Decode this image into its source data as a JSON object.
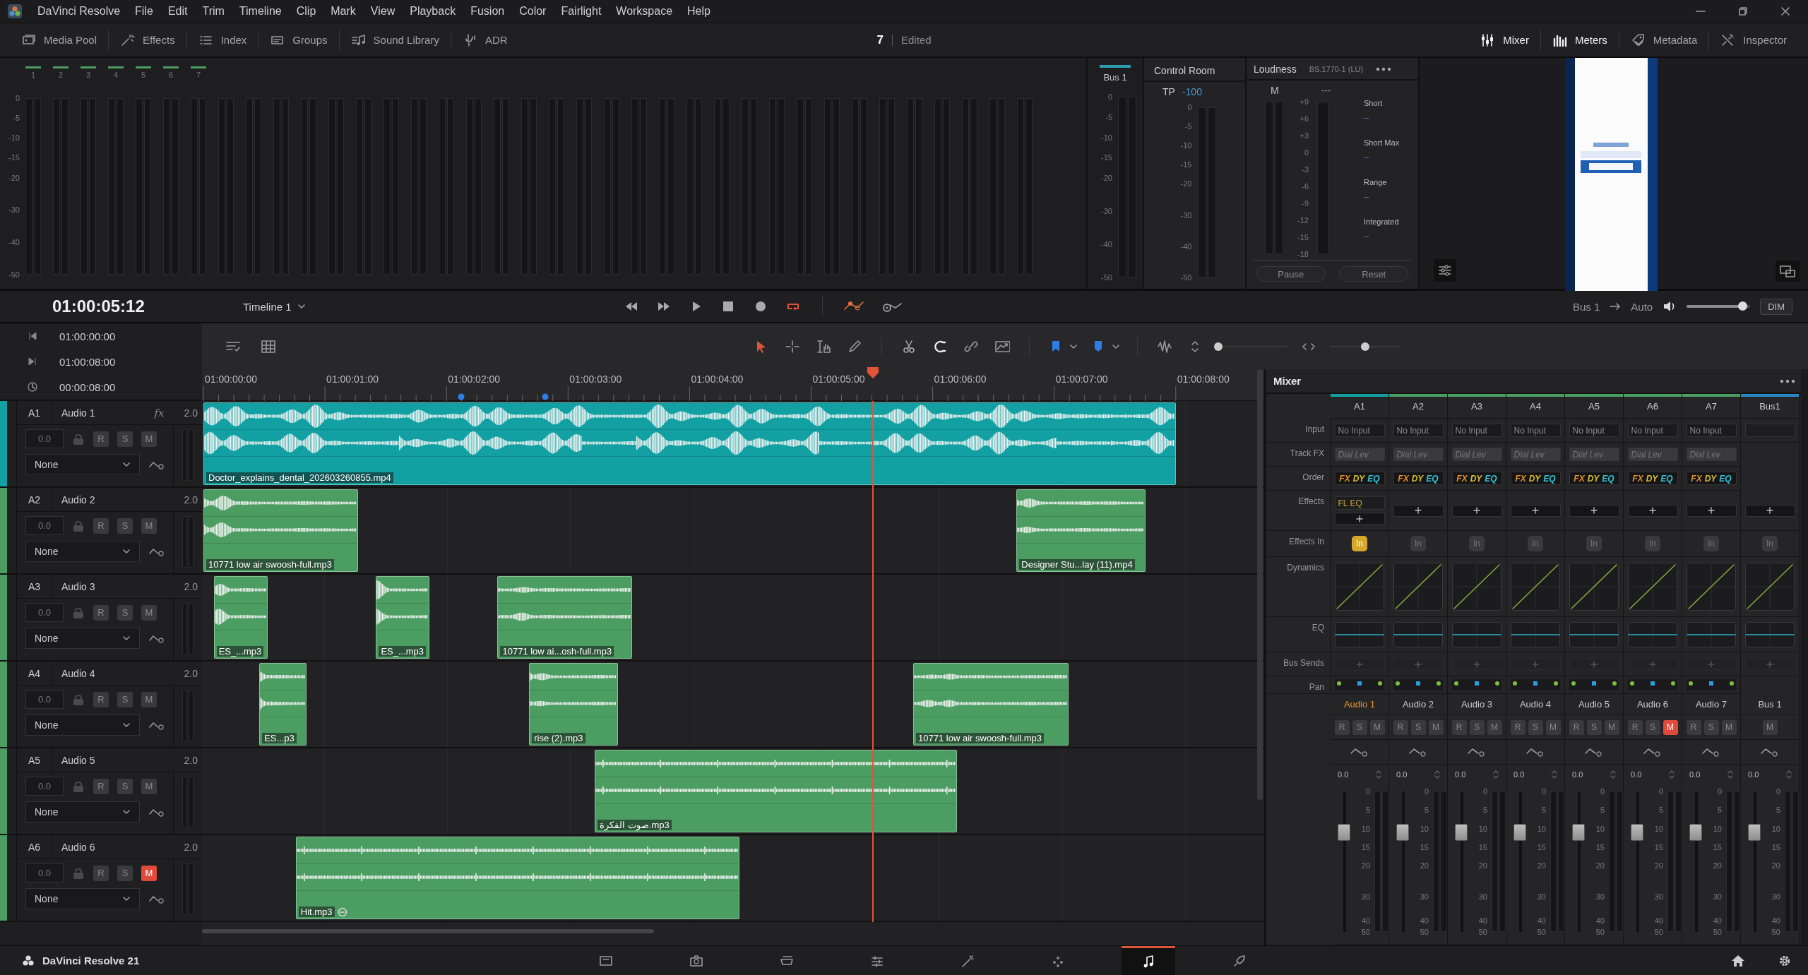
{
  "menu_bar": {
    "app_name": "DaVinci Resolve",
    "items": [
      "File",
      "Edit",
      "Trim",
      "Timeline",
      "Clip",
      "Mark",
      "View",
      "Playback",
      "Fusion",
      "Color",
      "Fairlight",
      "Workspace",
      "Help"
    ]
  },
  "toolbar": {
    "left": [
      {
        "label": "Media Pool"
      },
      {
        "label": "Effects"
      },
      {
        "label": "Index"
      },
      {
        "label": "Groups"
      },
      {
        "label": "Sound Library"
      },
      {
        "label": "ADR"
      }
    ],
    "project": "7",
    "status": "Edited",
    "right": [
      {
        "label": "Mixer",
        "selected": true
      },
      {
        "label": "Meters",
        "selected": true
      },
      {
        "label": "Metadata",
        "selected": false
      },
      {
        "label": "Inspector",
        "selected": false
      }
    ]
  },
  "meters": {
    "channels": [
      "1",
      "2",
      "3",
      "4",
      "5",
      "6",
      "7"
    ],
    "scale": [
      "0",
      "-5",
      "-10",
      "-15",
      "-20",
      "-30",
      "-40",
      "-50"
    ]
  },
  "bus_meter": {
    "title": "Bus 1",
    "scale": [
      "0",
      "-5",
      "-10",
      "-15",
      "-20",
      "-30",
      "-40",
      "-50"
    ]
  },
  "control_room": {
    "title": "Control Room",
    "tp_label": "TP",
    "tp_value": "-100",
    "scale": [
      "0",
      "-5",
      "-10",
      "-15",
      "-20",
      "-30",
      "-40",
      "-50"
    ]
  },
  "loudness": {
    "title": "Loudness",
    "standard": "BS.1770-1 (LU)",
    "m_label": "M",
    "m_value": "---",
    "scale": [
      "+9",
      "+6",
      "+3",
      "0",
      "-3",
      "-6",
      "-9",
      "-12",
      "-15",
      "-18"
    ],
    "readings": [
      {
        "label": "Short",
        "value": "--"
      },
      {
        "label": "Short Max",
        "value": "--"
      },
      {
        "label": "Range",
        "value": "--"
      },
      {
        "label": "Integrated",
        "value": "--"
      }
    ],
    "buttons": [
      "Pause",
      "Reset"
    ]
  },
  "transport": {
    "timecode": "01:00:05:12",
    "timeline": "Timeline 1",
    "loop": true,
    "output": "Bus 1",
    "mode": "Auto",
    "volume": {
      "level": 0.88
    },
    "dim": "DIM"
  },
  "timecodes": [
    "01:00:00:00",
    "01:00:08:00",
    "00:00:08:00"
  ],
  "zoom_sliders": [
    {
      "level": 0.02
    },
    {
      "level": 0.5
    }
  ],
  "ruler": [
    "01:00:00:00",
    "01:00:01:00",
    "01:00:02:00",
    "01:00:03:00",
    "01:00:04:00",
    "01:00:05:00",
    "01:00:06:00",
    "01:00:07:00",
    "01:00:08:00"
  ],
  "tracks": [
    {
      "id": "A1",
      "name": "Audio 1",
      "fx": "fx",
      "format": "2.0",
      "color": "#13a0a2",
      "volume": "0.0",
      "record": {
        "label": "R",
        "on": false
      },
      "solo": {
        "label": "S",
        "on": false
      },
      "mute": {
        "label": "M",
        "on": false
      },
      "automation": "None",
      "clips": [
        {
          "label": "Doctor_explains_dental_202603260855.mp4"
        }
      ]
    },
    {
      "id": "A2",
      "name": "Audio 2",
      "format": "2.0",
      "color": "#4b9d62",
      "volume": "0.0",
      "record": {
        "label": "R",
        "on": false
      },
      "solo": {
        "label": "S",
        "on": false
      },
      "mute": {
        "label": "M",
        "on": false
      },
      "automation": "None",
      "clips": [
        {
          "label": "10771 low air swoosh-full.mp3"
        },
        {
          "label": "Designer Stu...lay (11).mp4"
        }
      ]
    },
    {
      "id": "A3",
      "name": "Audio 3",
      "format": "2.0",
      "color": "#4b9d62",
      "volume": "0.0",
      "record": {
        "label": "R",
        "on": false
      },
      "solo": {
        "label": "S",
        "on": false
      },
      "mute": {
        "label": "M",
        "on": false
      },
      "automation": "None",
      "clips": [
        {
          "label": "ES_...mp3"
        },
        {
          "label": "ES_...mp3"
        },
        {
          "label": "10771 low ai...osh-full.mp3"
        }
      ]
    },
    {
      "id": "A4",
      "name": "Audio 4",
      "format": "2.0",
      "color": "#4b9d62",
      "volume": "0.0",
      "record": {
        "label": "R",
        "on": false
      },
      "solo": {
        "label": "S",
        "on": false
      },
      "mute": {
        "label": "M",
        "on": false
      },
      "automation": "None",
      "clips": [
        {
          "label": "ES...p3"
        },
        {
          "label": "rise (2).mp3"
        },
        {
          "label": "10771 low air swoosh-full.mp3"
        }
      ]
    },
    {
      "id": "A5",
      "name": "Audio 5",
      "format": "2.0",
      "color": "#4b9d62",
      "volume": "0.0",
      "record": {
        "label": "R",
        "on": false
      },
      "solo": {
        "label": "S",
        "on": false
      },
      "mute": {
        "label": "M",
        "on": false
      },
      "automation": "None",
      "clips": [
        {
          "label": "صوت الفكرة.mp3"
        }
      ]
    },
    {
      "id": "A6",
      "name": "Audio 6",
      "format": "2.0",
      "color": "#4b9d62",
      "volume": "0.0",
      "record": {
        "label": "R",
        "on": false
      },
      "solo": {
        "label": "S",
        "on": false
      },
      "mute": {
        "label": "M",
        "on": true
      },
      "automation": "None",
      "clips": [
        {
          "label": "Hit.mp3",
          "status_icon": true
        }
      ]
    }
  ],
  "mixer": {
    "title": "Mixer",
    "row_labels": [
      "Input",
      "Track FX",
      "Order",
      "Effects",
      "Effects In",
      "Dynamics",
      "EQ",
      "Bus Sends",
      "Pan"
    ],
    "channels": [
      {
        "id": "A1",
        "kind": "track",
        "color": "#13a0a2",
        "input": "No Input",
        "track_fx": "Dial Lev",
        "order": [
          "FX",
          "DY",
          "EQ"
        ],
        "effects": [
          "FL EQ"
        ],
        "effects_in": true,
        "effects_in_label": "In",
        "name": "Audio 1",
        "selected": true,
        "record": {
          "label": "R",
          "on": false
        },
        "solo": {
          "label": "S",
          "on": false
        },
        "mute": {
          "label": "M",
          "on": false
        },
        "volume": "0.0",
        "level": 0.71,
        "scale": [
          "0",
          "5",
          "10",
          "15",
          "20",
          "30",
          "40",
          "50"
        ]
      },
      {
        "id": "A2",
        "kind": "track",
        "color": "#4b9d62",
        "input": "No Input",
        "track_fx": "Dial Lev",
        "order": [
          "FX",
          "DY",
          "EQ"
        ],
        "effects_in": false,
        "effects_in_label": "In",
        "name": "Audio 2",
        "selected": false,
        "record": {
          "label": "R",
          "on": false
        },
        "solo": {
          "label": "S",
          "on": false
        },
        "mute": {
          "label": "M",
          "on": false
        },
        "volume": "0.0",
        "level": 0.71,
        "scale": [
          "0",
          "5",
          "10",
          "15",
          "20",
          "30",
          "40",
          "50"
        ]
      },
      {
        "id": "A3",
        "kind": "track",
        "color": "#4b9d62",
        "input": "No Input",
        "track_fx": "Dial Lev",
        "order": [
          "FX",
          "DY",
          "EQ"
        ],
        "effects_in": false,
        "effects_in_label": "In",
        "name": "Audio 3",
        "selected": false,
        "record": {
          "label": "R",
          "on": false
        },
        "solo": {
          "label": "S",
          "on": false
        },
        "mute": {
          "label": "M",
          "on": false
        },
        "volume": "0.0",
        "level": 0.71,
        "scale": [
          "0",
          "5",
          "10",
          "15",
          "20",
          "30",
          "40",
          "50"
        ]
      },
      {
        "id": "A4",
        "kind": "track",
        "color": "#4b9d62",
        "input": "No Input",
        "track_fx": "Dial Lev",
        "order": [
          "FX",
          "DY",
          "EQ"
        ],
        "effects_in": false,
        "effects_in_label": "In",
        "name": "Audio 4",
        "selected": false,
        "record": {
          "label": "R",
          "on": false
        },
        "solo": {
          "label": "S",
          "on": false
        },
        "mute": {
          "label": "M",
          "on": false
        },
        "volume": "0.0",
        "level": 0.71,
        "scale": [
          "0",
          "5",
          "10",
          "15",
          "20",
          "30",
          "40",
          "50"
        ]
      },
      {
        "id": "A5",
        "kind": "track",
        "color": "#4b9d62",
        "input": "No Input",
        "track_fx": "Dial Lev",
        "order": [
          "FX",
          "DY",
          "EQ"
        ],
        "effects_in": false,
        "effects_in_label": "In",
        "name": "Audio 5",
        "selected": false,
        "record": {
          "label": "R",
          "on": false
        },
        "solo": {
          "label": "S",
          "on": false
        },
        "mute": {
          "label": "M",
          "on": false
        },
        "volume": "0.0",
        "level": 0.71,
        "scale": [
          "0",
          "5",
          "10",
          "15",
          "20",
          "30",
          "40",
          "50"
        ]
      },
      {
        "id": "A6",
        "kind": "track",
        "color": "#4b9d62",
        "input": "No Input",
        "track_fx": "Dial Lev",
        "order": [
          "FX",
          "DY",
          "EQ"
        ],
        "effects_in": false,
        "effects_in_label": "In",
        "name": "Audio 6",
        "selected": false,
        "record": {
          "label": "R",
          "on": false
        },
        "solo": {
          "label": "S",
          "on": false
        },
        "mute": {
          "label": "M",
          "on": true
        },
        "volume": "0.0",
        "level": 0.71,
        "scale": [
          "0",
          "5",
          "10",
          "15",
          "20",
          "30",
          "40",
          "50"
        ]
      },
      {
        "id": "A7",
        "kind": "track",
        "color": "#4b9d62",
        "input": "No Input",
        "track_fx": "Dial Lev",
        "order": [
          "FX",
          "DY",
          "EQ"
        ],
        "effects_in": false,
        "effects_in_label": "In",
        "name": "Audio 7",
        "selected": false,
        "record": {
          "label": "R",
          "on": false
        },
        "solo": {
          "label": "S",
          "on": false
        },
        "mute": {
          "label": "M",
          "on": false
        },
        "volume": "0.0",
        "level": 0.71,
        "scale": [
          "0",
          "5",
          "10",
          "15",
          "20",
          "30",
          "40",
          "50"
        ]
      },
      {
        "id": "Bus1",
        "kind": "bus",
        "color": "#2b86c8",
        "effects_in": false,
        "effects_in_label": "In",
        "name": "Bus 1",
        "selected": false,
        "mute": {
          "label": "M",
          "on": false
        },
        "volume": "0.0",
        "level": 0.71,
        "scale": [
          "0",
          "5",
          "10",
          "15",
          "20",
          "30",
          "40",
          "50"
        ]
      }
    ]
  },
  "bottom_bar": {
    "app": "DaVinci Resolve 21",
    "pages": [
      {
        "selected": false
      },
      {
        "selected": false
      },
      {
        "selected": false
      },
      {
        "selected": false
      },
      {
        "selected": false
      },
      {
        "selected": false
      },
      {
        "selected": true
      },
      {
        "selected": false
      }
    ]
  }
}
